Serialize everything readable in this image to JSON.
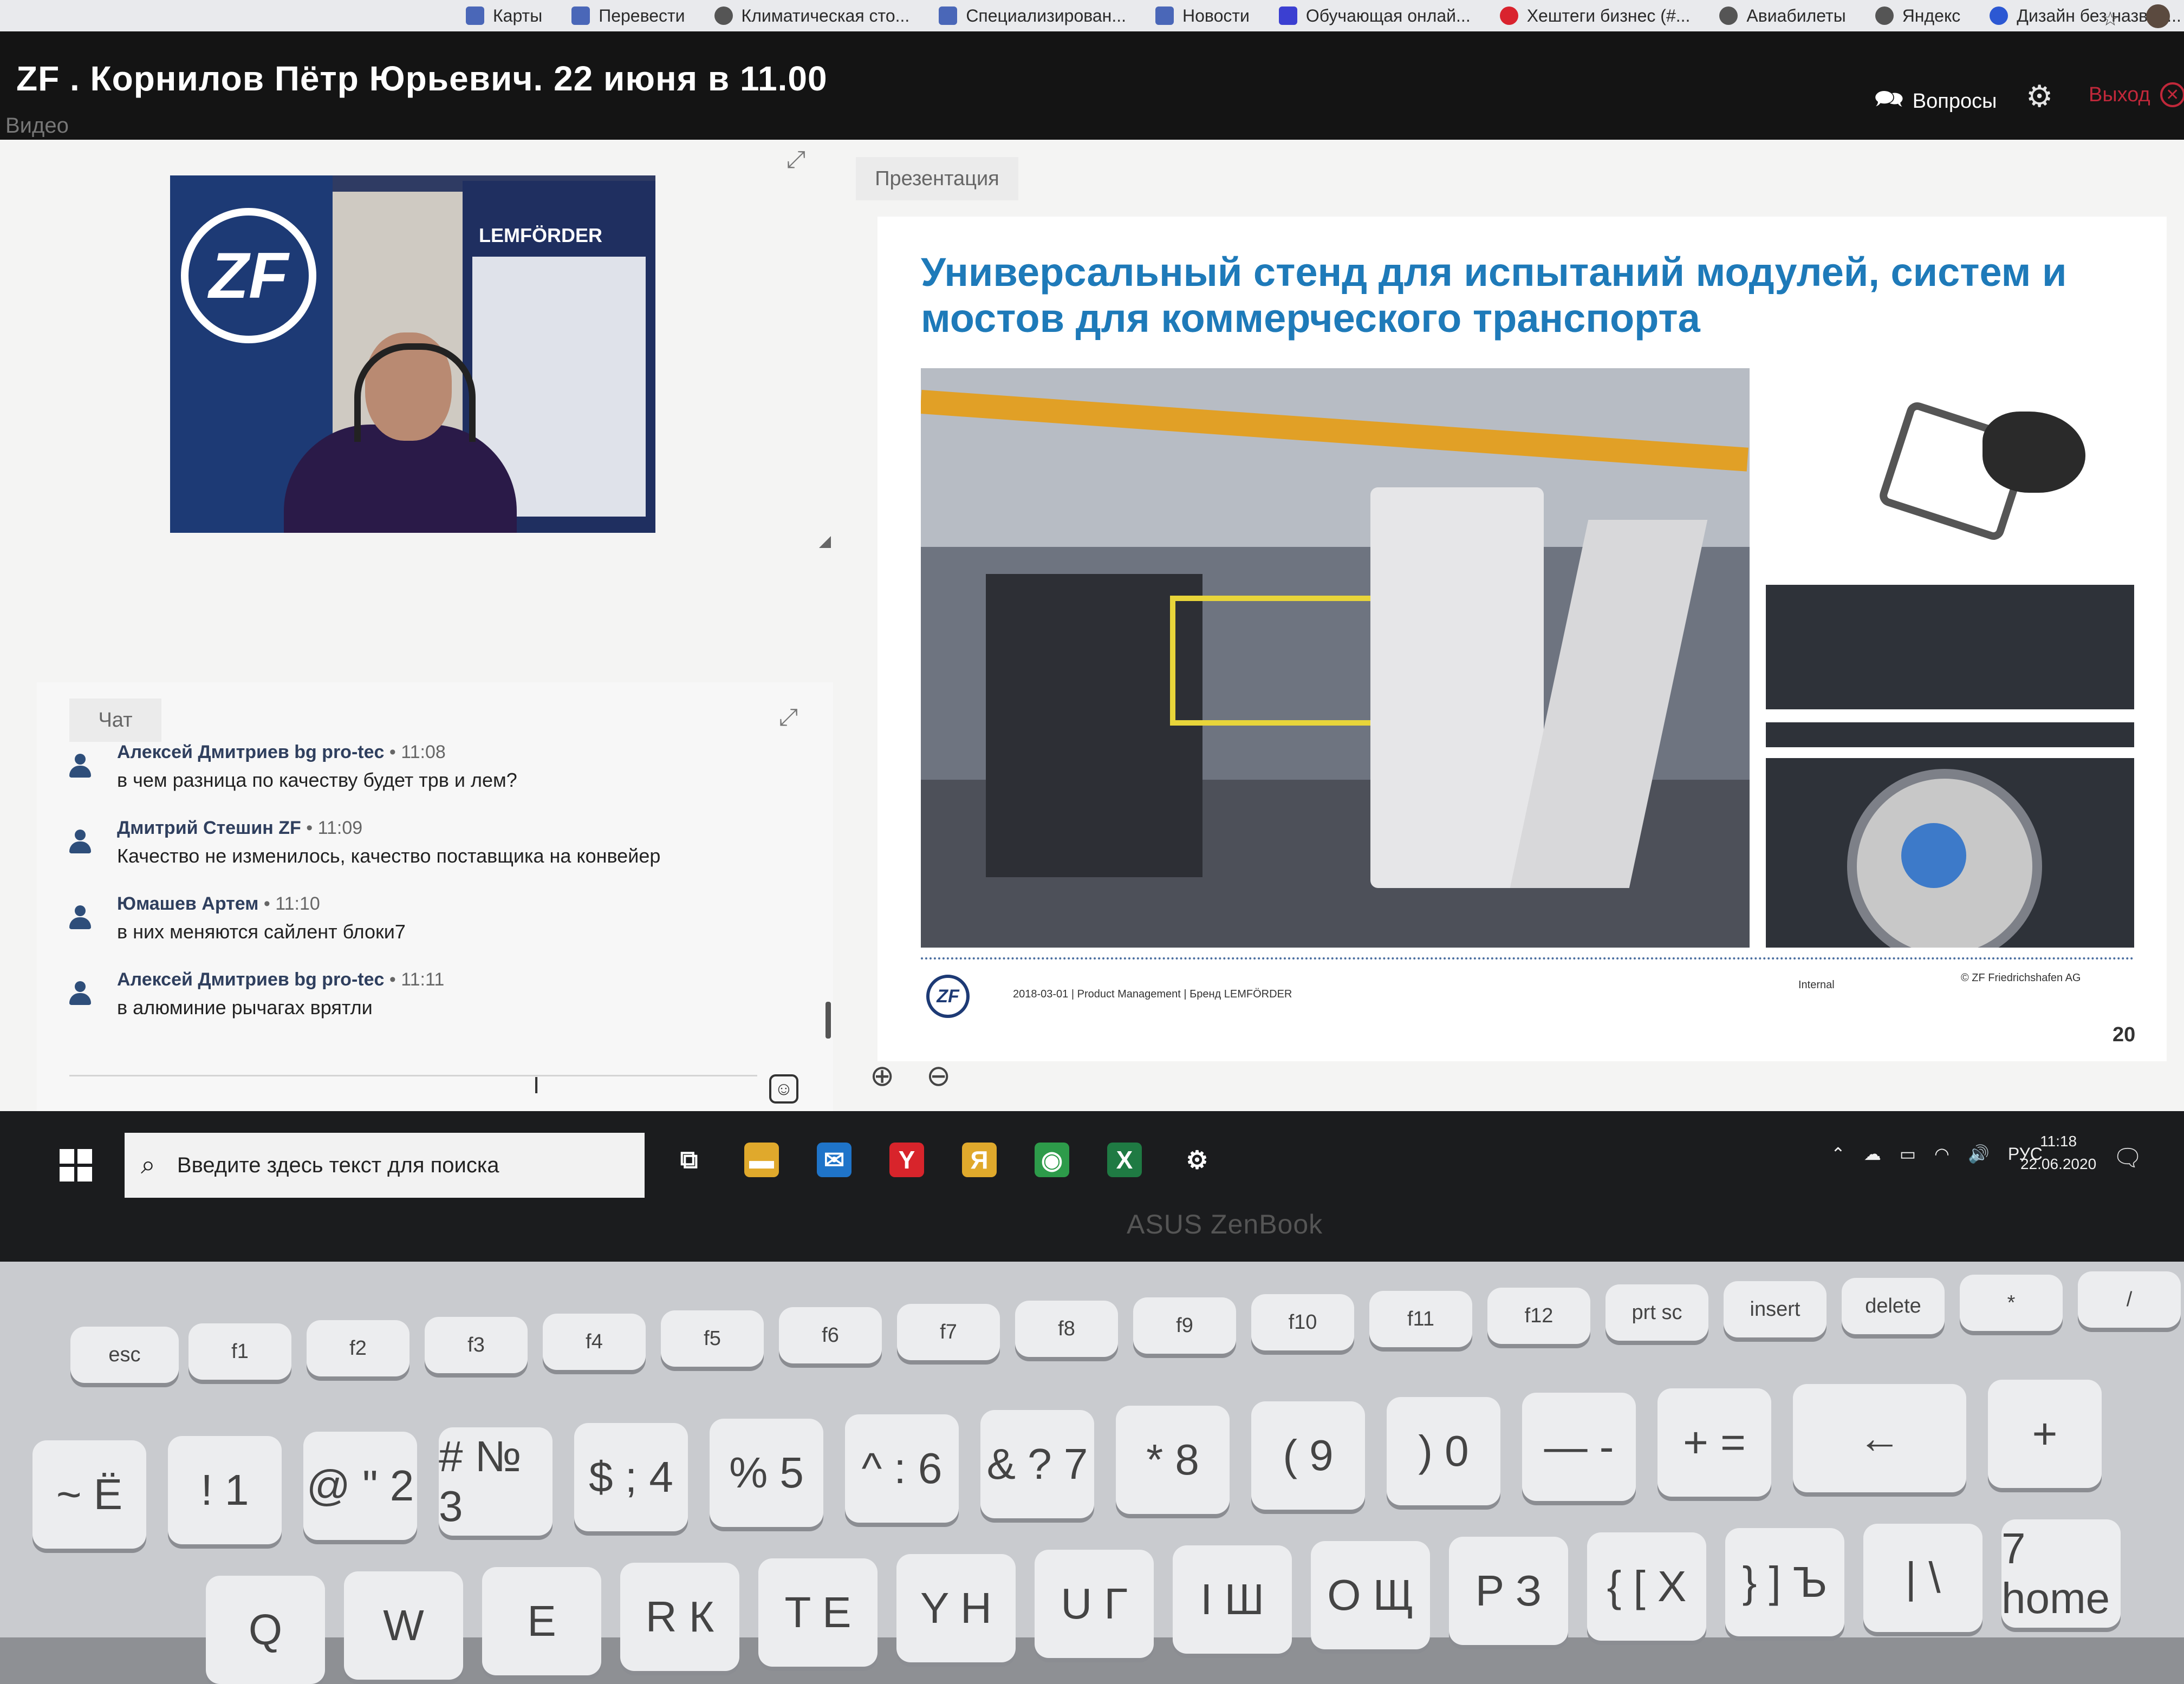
{
  "browser": {
    "bookmarks": [
      {
        "label": "Карты",
        "icon": "maps-icon"
      },
      {
        "label": "Перевести",
        "icon": "translate-icon"
      },
      {
        "label": "Климатическая сто...",
        "icon": "climate-icon"
      },
      {
        "label": "Специализирован...",
        "icon": "special-icon"
      },
      {
        "label": "Новости",
        "icon": "news-icon"
      },
      {
        "label": "Обучающая онлай...",
        "icon": "s-icon"
      },
      {
        "label": "Хештеги бизнес (#...",
        "icon": "hashtag-icon"
      },
      {
        "label": "Авиабилеты",
        "icon": "globe-icon"
      },
      {
        "label": "Яндекс",
        "icon": "globe-icon"
      },
      {
        "label": "Дизайн без назван...",
        "icon": "canva-icon"
      }
    ]
  },
  "webinar": {
    "title": "ZF . Корнилов Пётр Юрьевич. 22 июня в 11.00",
    "questions_label": "Вопросы",
    "exit_label": "Выход"
  },
  "video": {
    "label": "Видео",
    "banner_zf": "ZF",
    "banner_lemforder": "LEMFÖRDER"
  },
  "chat": {
    "label": "Чат",
    "messages": [
      {
        "author": "Алексей Дмитриев bg pro-tec",
        "time": "11:08",
        "text": "в чем разница по качеству будет трв и лем?"
      },
      {
        "author": "Дмитрий Стешин ZF",
        "time": "11:09",
        "text": "Качество не изменилось, качество поставщика на конвейер"
      },
      {
        "author": "Юмашев Артем",
        "time": "11:10",
        "text": "в них меняются сайлент блоки7"
      },
      {
        "author": "Алексей Дмитриев bg pro-tec",
        "time": "11:11",
        "text": "в алюминие рычагах врятли"
      }
    ],
    "separator": " • "
  },
  "presentation": {
    "label": "Презентация",
    "slide": {
      "title": "Универсальный стенд для испытаний модулей, систем и мостов для коммерческого транспорта",
      "logo": "ZF",
      "footer": "2018-03-01 | Product Management | Бренд LEMFÖRDER",
      "classification": "Internal",
      "copyright": "© ZF Friedrichshafen AG",
      "page": "20"
    }
  },
  "taskbar": {
    "search_placeholder": "Введите здесь текст для поиска",
    "language": "РУС",
    "time": "11:18",
    "date": "22.06.2020",
    "apps": [
      {
        "name": "task-view",
        "glyph": "⧉",
        "color": "#1b1c1e"
      },
      {
        "name": "file-explorer",
        "glyph": "▬",
        "color": "#e0a92c"
      },
      {
        "name": "mail",
        "glyph": "✉",
        "color": "#1f74c9"
      },
      {
        "name": "yandex-browser",
        "glyph": "Y",
        "color": "#d8242b"
      },
      {
        "name": "yandex",
        "glyph": "Я",
        "color": "#e0a92c"
      },
      {
        "name": "chrome",
        "glyph": "◉",
        "color": "#2d9b4a"
      },
      {
        "name": "excel",
        "glyph": "X",
        "color": "#1f7a43"
      },
      {
        "name": "settings",
        "glyph": "⚙",
        "color": "#1b1c1e"
      }
    ]
  },
  "laptop": {
    "brand": "ASUS ZenBook",
    "function_keys": [
      "esc",
      "f1",
      "f2",
      "f3",
      "f4",
      "f5",
      "f6",
      "f7",
      "f8",
      "f9",
      "f10",
      "f11",
      "f12",
      "prt sc",
      "insert",
      "delete",
      "*",
      "/"
    ],
    "number_keys": [
      "~ Ё",
      "! 1",
      "@ \" 2",
      "# № 3",
      "$ ; 4",
      "% 5",
      "^ : 6",
      "& ? 7",
      "* 8",
      "( 9",
      ") 0",
      "— -",
      "+ =",
      "←",
      "+",
      "−"
    ],
    "letter_keys": [
      "Q",
      "W",
      "E",
      "R К",
      "T Е",
      "Y Н",
      "U Г",
      "I Ш",
      "O Щ",
      "P З",
      "{ [ Х",
      "} ] Ъ",
      "| \\",
      "7 home"
    ]
  }
}
